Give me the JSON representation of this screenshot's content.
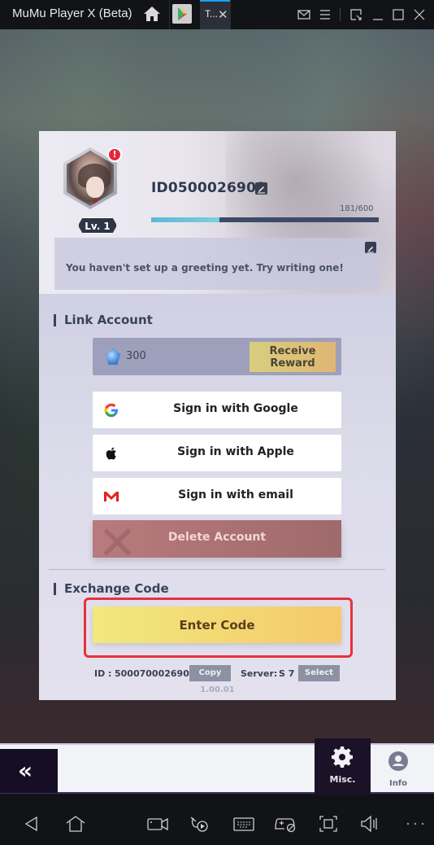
{
  "window": {
    "app_title": "MuMu Player X  (Beta)",
    "tab_label": "T...",
    "tab_close": "✕"
  },
  "profile": {
    "user_id": "ID0500026901",
    "level": "Lv. 1",
    "alert": "!",
    "xp_text": "181/600",
    "xp_progress": 0.3017,
    "greeting": "You haven't set up a greeting yet. Try writing one!"
  },
  "link_account": {
    "title": "Link Account",
    "reward_amount": "300",
    "receive_reward_line1": "Receive",
    "receive_reward_line2": "Reward",
    "google_label": "Sign in with Google",
    "apple_label": "Sign in with Apple",
    "email_label": "Sign in with email",
    "delete_label": "Delete Account"
  },
  "exchange_code": {
    "title": "Exchange Code",
    "enter_code_label": "Enter Code"
  },
  "footer": {
    "id_label": "ID :",
    "id_value": "5000700026901",
    "copy_label": "Copy",
    "server_label": "Server:",
    "server_value": "S 7",
    "select_label": "Select",
    "version": "1.00.01"
  },
  "bottom_nav": {
    "back_glyph": "«",
    "misc_label": "Misc.",
    "info_label": "Info"
  },
  "colors": {
    "highlight": "#e8303e",
    "xp_fill": "#5cb9d6",
    "tab_accent": "#1ea1f1"
  }
}
